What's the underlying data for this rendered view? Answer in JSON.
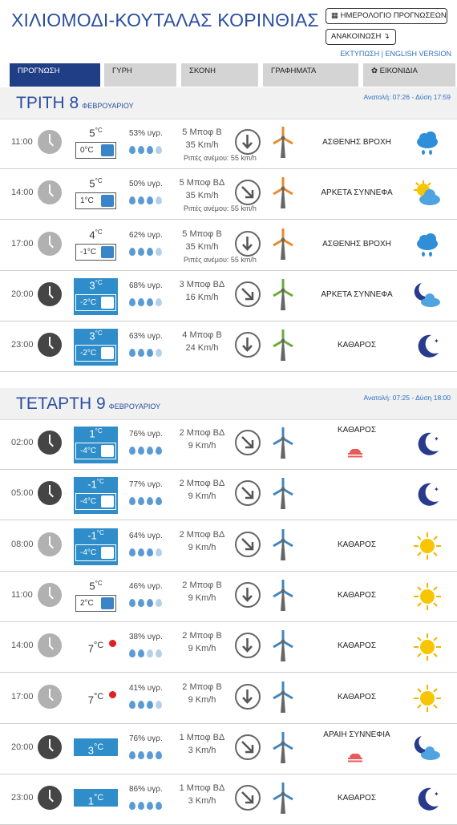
{
  "header": {
    "title": "ΧΙΛΙΟΜΟΔΙ-ΚΟΥΤΑΛΑΣ ΚΟΡΙΝΘΙΑΣ",
    "calendar_button": "ΗΜΕΡΟΛΟΓΙΟ ΠΡΟΓΝΩΣΕΩΝ",
    "announcement_button": "ΑΝΑΚΟΙΝΩΣΗ",
    "print_link": "ΕΚΤΥΠΩΣΗ",
    "english_link": "ENGLISH VERSION"
  },
  "tabs": [
    "ΠΡΟΓΝΩΣΗ",
    "ΓΥΡΗ",
    "ΣΚΟΝΗ",
    "ΓΡΑΦΗΜΑΤΑ",
    "ΕΙΚΟΝΙΔΙΑ"
  ],
  "colors": {
    "accent": "#1f3e86",
    "cold_box": "#2f8ec9",
    "title": "#2b4fa0",
    "turbine_orange": "#e8892b",
    "turbine_green": "#6aaa3a",
    "turbine_blue": "#3f86c0"
  },
  "days": [
    {
      "name": "ΤΡΙΤΗ 8",
      "month": "ΦΕΒΡΟΥΑΡΙΟΥ",
      "sunrise": "Ανατολή: 07:26",
      "sunset": "Δύση 17:59",
      "rows": [
        {
          "time": "11:00",
          "clock": "day",
          "temp": "5",
          "feels": "0°C",
          "cold": false,
          "humidity": "53% υγρ.",
          "drops": 3,
          "wind_bf": "5 Μποφ Β",
          "wind_kmh": "35 Km/h",
          "gust": "Ριπές ανέμου: 55 km/h",
          "dir_icon": "arrow-down-icon",
          "turbine": "orange",
          "condition": "ΑΣΘΕΝΗΣ ΒΡΟΧΗ",
          "icon": "rain-cloud-icon"
        },
        {
          "time": "14:00",
          "clock": "day",
          "temp": "5",
          "feels": "1°C",
          "cold": false,
          "humidity": "50% υγρ.",
          "drops": 3,
          "wind_bf": "5 Μποφ ΒΔ",
          "wind_kmh": "35 Km/h",
          "gust": "Ριπές ανέμου: 55 km/h",
          "dir_icon": "arrow-down-right-icon",
          "turbine": "orange",
          "condition": "ΑΡΚΕΤΑ ΣΥΝΝΕΦΑ",
          "icon": "sun-cloud-icon"
        },
        {
          "time": "17:00",
          "clock": "day",
          "temp": "4",
          "feels": "-1°C",
          "cold": false,
          "humidity": "62% υγρ.",
          "drops": 3,
          "wind_bf": "5 Μποφ Β",
          "wind_kmh": "35 Km/h",
          "gust": "Ριπές ανέμου: 55 km/h",
          "dir_icon": "arrow-down-icon",
          "turbine": "orange",
          "condition": "ΑΣΘΕΝΗΣ ΒΡΟΧΗ",
          "icon": "rain-cloud-icon"
        },
        {
          "time": "20:00",
          "clock": "night",
          "temp": "3",
          "feels": "-2°C",
          "cold": true,
          "humidity": "68% υγρ.",
          "drops": 3,
          "wind_bf": "3 Μποφ ΒΔ",
          "wind_kmh": "16 Km/h",
          "gust": "",
          "dir_icon": "arrow-down-right-icon",
          "turbine": "green",
          "condition": "ΑΡΚΕΤΑ ΣΥΝΝΕΦΑ",
          "icon": "moon-cloud-icon"
        },
        {
          "time": "23:00",
          "clock": "night",
          "temp": "3",
          "feels": "-2°C",
          "cold": true,
          "humidity": "63% υγρ.",
          "drops": 3,
          "wind_bf": "4 Μποφ Β",
          "wind_kmh": "24 Km/h",
          "gust": "",
          "dir_icon": "arrow-down-icon",
          "turbine": "green",
          "condition": "ΚΑΘΑΡΟΣ",
          "icon": "moon-icon"
        }
      ]
    },
    {
      "name": "ΤΕΤΑΡΤΗ 9",
      "month": "ΦΕΒΡΟΥΑΡΙΟΥ",
      "sunrise": "Ανατολή: 07:25",
      "sunset": "Δύση 18:00",
      "rows": [
        {
          "time": "02:00",
          "clock": "night",
          "temp": "1",
          "feels": "-4°C",
          "cold": true,
          "humidity": "76% υγρ.",
          "drops": 4,
          "wind_bf": "2 Μποφ ΒΔ",
          "wind_kmh": "9 Km/h",
          "gust": "",
          "dir_icon": "arrow-down-right-icon",
          "turbine": "blue",
          "condition": "ΚΑΘΑΡΟΣ",
          "fog": true,
          "icon": "moon-icon"
        },
        {
          "time": "05:00",
          "clock": "night",
          "temp": "-1",
          "feels": "-4°C",
          "cold": true,
          "humidity": "77% υγρ.",
          "drops": 4,
          "wind_bf": "2 Μποφ ΒΔ",
          "wind_kmh": "9 Km/h",
          "gust": "",
          "dir_icon": "arrow-down-right-icon",
          "turbine": "blue",
          "condition": "",
          "icon": "moon-icon"
        },
        {
          "time": "08:00",
          "clock": "day",
          "temp": "-1",
          "feels": "-4°C",
          "cold": true,
          "humidity": "64% υγρ.",
          "drops": 3,
          "wind_bf": "2 Μποφ ΒΔ",
          "wind_kmh": "9 Km/h",
          "gust": "",
          "dir_icon": "arrow-down-right-icon",
          "turbine": "blue",
          "condition": "ΚΑΘΑΡΟΣ",
          "icon": "sun-icon"
        },
        {
          "time": "11:00",
          "clock": "day",
          "temp": "5",
          "feels": "2°C",
          "cold": false,
          "humidity": "46% υγρ.",
          "drops": 3,
          "wind_bf": "2 Μποφ Β",
          "wind_kmh": "9 Km/h",
          "gust": "",
          "dir_icon": "arrow-down-icon",
          "turbine": "blue",
          "condition": "ΚΑΘΑΡΟΣ",
          "icon": "sun-icon"
        },
        {
          "time": "14:00",
          "clock": "day",
          "temp": "7",
          "feels": "",
          "cold": false,
          "hot": true,
          "humidity": "38% υγρ.",
          "drops": 2,
          "wind_bf": "2 Μποφ Β",
          "wind_kmh": "9 Km/h",
          "gust": "",
          "dir_icon": "arrow-down-icon",
          "turbine": "blue",
          "condition": "ΚΑΘΑΡΟΣ",
          "icon": "sun-icon"
        },
        {
          "time": "17:00",
          "clock": "day",
          "temp": "7",
          "feels": "",
          "cold": false,
          "hot": true,
          "humidity": "41% υγρ.",
          "drops": 3,
          "wind_bf": "2 Μποφ Β",
          "wind_kmh": "9 Km/h",
          "gust": "",
          "dir_icon": "arrow-down-icon",
          "turbine": "blue",
          "condition": "ΚΑΘΑΡΟΣ",
          "icon": "sun-icon"
        },
        {
          "time": "20:00",
          "clock": "night",
          "temp": "3",
          "feels": "",
          "cold": true,
          "humidity": "76% υγρ.",
          "drops": 4,
          "wind_bf": "1 Μποφ ΒΔ",
          "wind_kmh": "3 Km/h",
          "gust": "",
          "dir_icon": "arrow-down-right-icon",
          "turbine": "blue",
          "condition": "ΑΡΑΙΗ ΣΥΝΝΕΦΙΑ",
          "fog": true,
          "icon": "moon-cloud-icon"
        },
        {
          "time": "23:00",
          "clock": "night",
          "temp": "1",
          "feels": "",
          "cold": true,
          "humidity": "86% υγρ.",
          "drops": 4,
          "wind_bf": "1 Μποφ ΒΔ",
          "wind_kmh": "3 Km/h",
          "gust": "",
          "dir_icon": "arrow-down-right-icon",
          "turbine": "blue",
          "condition": "ΚΑΘΑΡΟΣ",
          "icon": "moon-icon"
        }
      ]
    }
  ]
}
